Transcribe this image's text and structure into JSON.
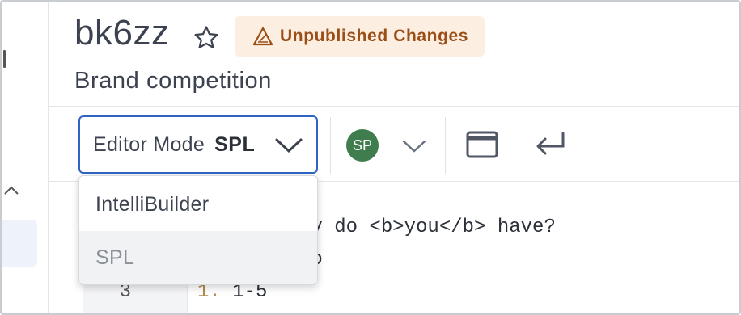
{
  "header": {
    "title": "bk6zz",
    "badge_label": "Unpublished Changes",
    "subtitle": "Brand competition"
  },
  "toolbar": {
    "mode_label": "Editor Mode",
    "mode_value": "SPL",
    "user_initials": "SP"
  },
  "dropdown": {
    "options": [
      {
        "label": "IntelliBuilder"
      },
      {
        "label": "SPL"
      }
    ]
  },
  "editor": {
    "lines": [
      {
        "text": "ny do <b>you</b> have?"
      },
      {
        "text": "io"
      },
      {
        "number": "3",
        "marker": "1.",
        "text": " 1-5"
      }
    ]
  },
  "colors": {
    "accent": "#2f64c4",
    "badge_bg": "#fdeee2",
    "badge_text": "#9a4f16",
    "avatar_bg": "#3f7d4e"
  },
  "icons": [
    "star-icon",
    "warning-icon",
    "chevron-down-icon",
    "window-icon",
    "return-icon"
  ]
}
